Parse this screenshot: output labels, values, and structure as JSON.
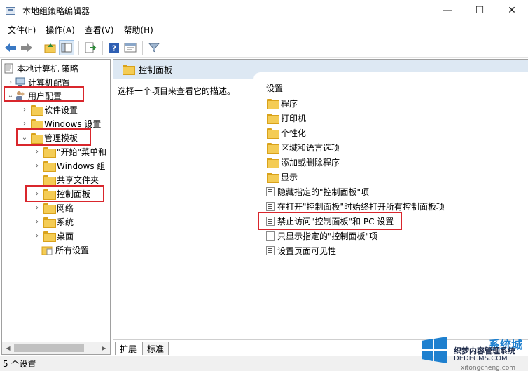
{
  "window": {
    "title": "本地组策略编辑器",
    "minimize_glyph": "—",
    "maximize_glyph": "☐",
    "close_glyph": "✕"
  },
  "menu": [
    "文件(F)",
    "操作(A)",
    "查看(V)",
    "帮助(H)"
  ],
  "toolbar_icons": [
    "back-arrow-icon",
    "forward-arrow-icon",
    "up-folder-icon",
    "show-hide-tree-icon",
    "export-list-icon",
    "help-icon",
    "properties-icon",
    "filter-icon"
  ],
  "tree": {
    "root": "本地计算机 策略",
    "computer_config": "计算机配置",
    "user_config": "用户配置",
    "software_settings": "软件设置",
    "windows_settings": "Windows 设置",
    "admin_templates": "管理模板",
    "start_menu": "\"开始\"菜单和",
    "windows_components": "Windows 组",
    "shared_folders": "共享文件夹",
    "control_panel": "控制面板",
    "network": "网络",
    "system": "系统",
    "desktop": "桌面",
    "all_settings": "所有设置"
  },
  "right_pane": {
    "header": "控制面板",
    "description": "选择一个项目来查看它的描述。",
    "column_header": "设置",
    "folders": [
      "程序",
      "打印机",
      "个性化",
      "区域和语言选项",
      "添加或删除程序",
      "显示"
    ],
    "settings": [
      "隐藏指定的\"控制面板\"项",
      "在打开\"控制面板\"时始终打开所有控制面板项",
      "禁止访问\"控制面板\"和 PC 设置",
      "只显示指定的\"控制面板\"项",
      "设置页面可见性"
    ]
  },
  "tabs": {
    "extended": "扩展",
    "standard": "标准"
  },
  "status": "5 个设置",
  "watermark": {
    "line1": "织梦内容管理系统",
    "line2": "DEDECMS.COM",
    "line3": "系统城",
    "line4": "xitongcheng.com"
  },
  "colors": {
    "highlight_box": "#d9262c",
    "folder": "#f4cc55",
    "header_strip": "#dde8f3"
  }
}
